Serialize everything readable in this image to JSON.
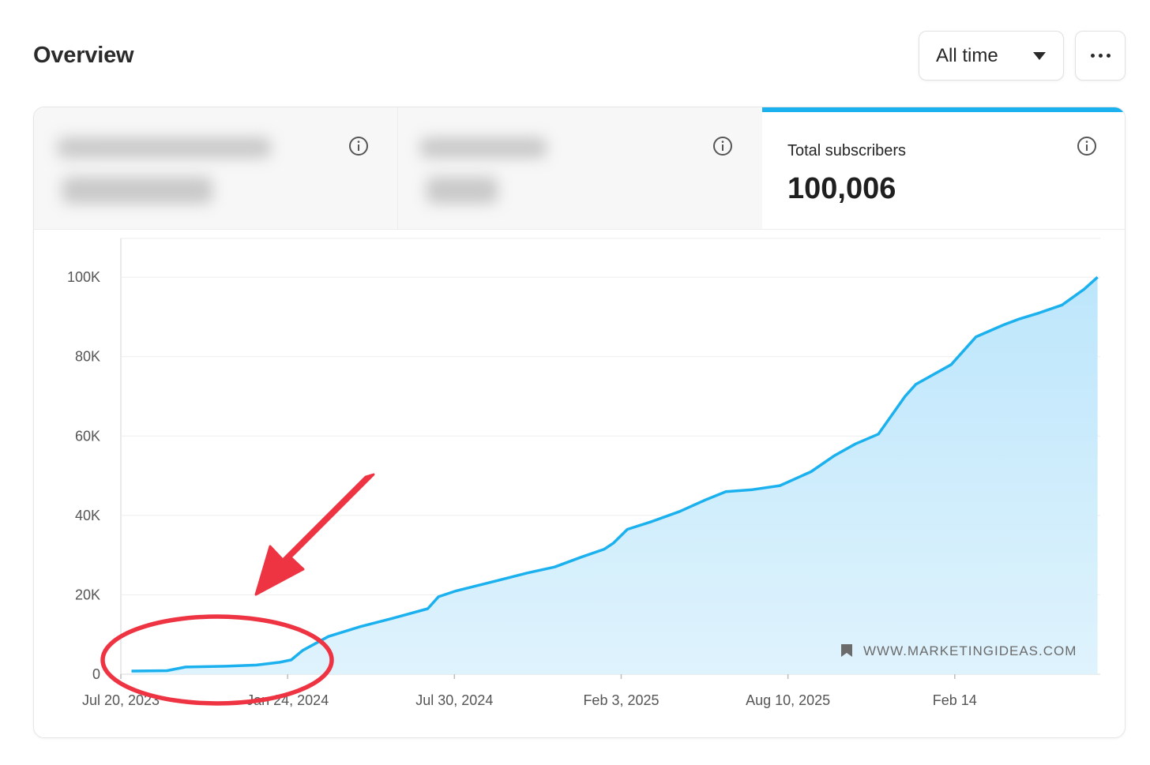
{
  "header": {
    "title": "Overview",
    "range": {
      "selected": "All time"
    }
  },
  "stats": [
    {
      "label": "",
      "value": "",
      "obscured": true
    },
    {
      "label": "",
      "value": "",
      "obscured": true
    },
    {
      "label": "Total subscribers",
      "value": "100,006",
      "active": true
    }
  ],
  "watermark": "WWW.MARKETINGIDEAS.COM",
  "colors": {
    "accent": "#1bb0ee",
    "area": "#c9ebfb",
    "annotation": "#ee3442"
  },
  "chart_data": {
    "type": "area",
    "xlabel": "",
    "ylabel": "",
    "ylim": [
      0,
      105000
    ],
    "x_ticks": [
      "Jul 20, 2023",
      "Jan 24, 2024",
      "Jul 30, 2024",
      "Feb 3, 2025",
      "Aug 10, 2025",
      "Feb 14"
    ],
    "y_ticks": [
      "0",
      "20K",
      "40K",
      "60K",
      "80K",
      "100K"
    ],
    "grid": true,
    "series": [
      {
        "x": [
          "2023-08-01",
          "2023-09-10",
          "2023-10-01",
          "2023-11-15",
          "2023-12-20",
          "2024-01-15",
          "2024-01-28",
          "2024-02-10",
          "2024-03-10",
          "2024-04-15",
          "2024-05-20",
          "2024-06-30",
          "2024-07-12",
          "2024-08-01",
          "2024-09-15",
          "2024-10-20",
          "2024-11-20",
          "2024-12-20",
          "2025-01-15",
          "2025-01-25",
          "2025-02-10",
          "2025-03-10",
          "2025-04-10",
          "2025-05-10",
          "2025-06-01",
          "2025-07-01",
          "2025-08-01",
          "2025-09-05",
          "2025-10-01",
          "2025-10-25",
          "2025-11-20",
          "2025-12-20",
          "2026-01-01",
          "2026-02-10",
          "2026-03-10",
          "2026-04-10",
          "2026-04-28",
          "2026-05-20",
          "2026-06-15",
          "2026-07-10",
          "2026-07-25"
        ],
        "y": [
          800,
          900,
          1800,
          2000,
          2300,
          3000,
          3600,
          6000,
          9500,
          12000,
          14000,
          16500,
          19500,
          21000,
          23500,
          25500,
          27000,
          29500,
          31500,
          33000,
          36500,
          38500,
          41000,
          44000,
          46000,
          46500,
          47500,
          51000,
          55000,
          58000,
          60500,
          70000,
          73000,
          78000,
          85000,
          88000,
          89500,
          91000,
          93000,
          97000,
          100006
        ]
      }
    ]
  }
}
